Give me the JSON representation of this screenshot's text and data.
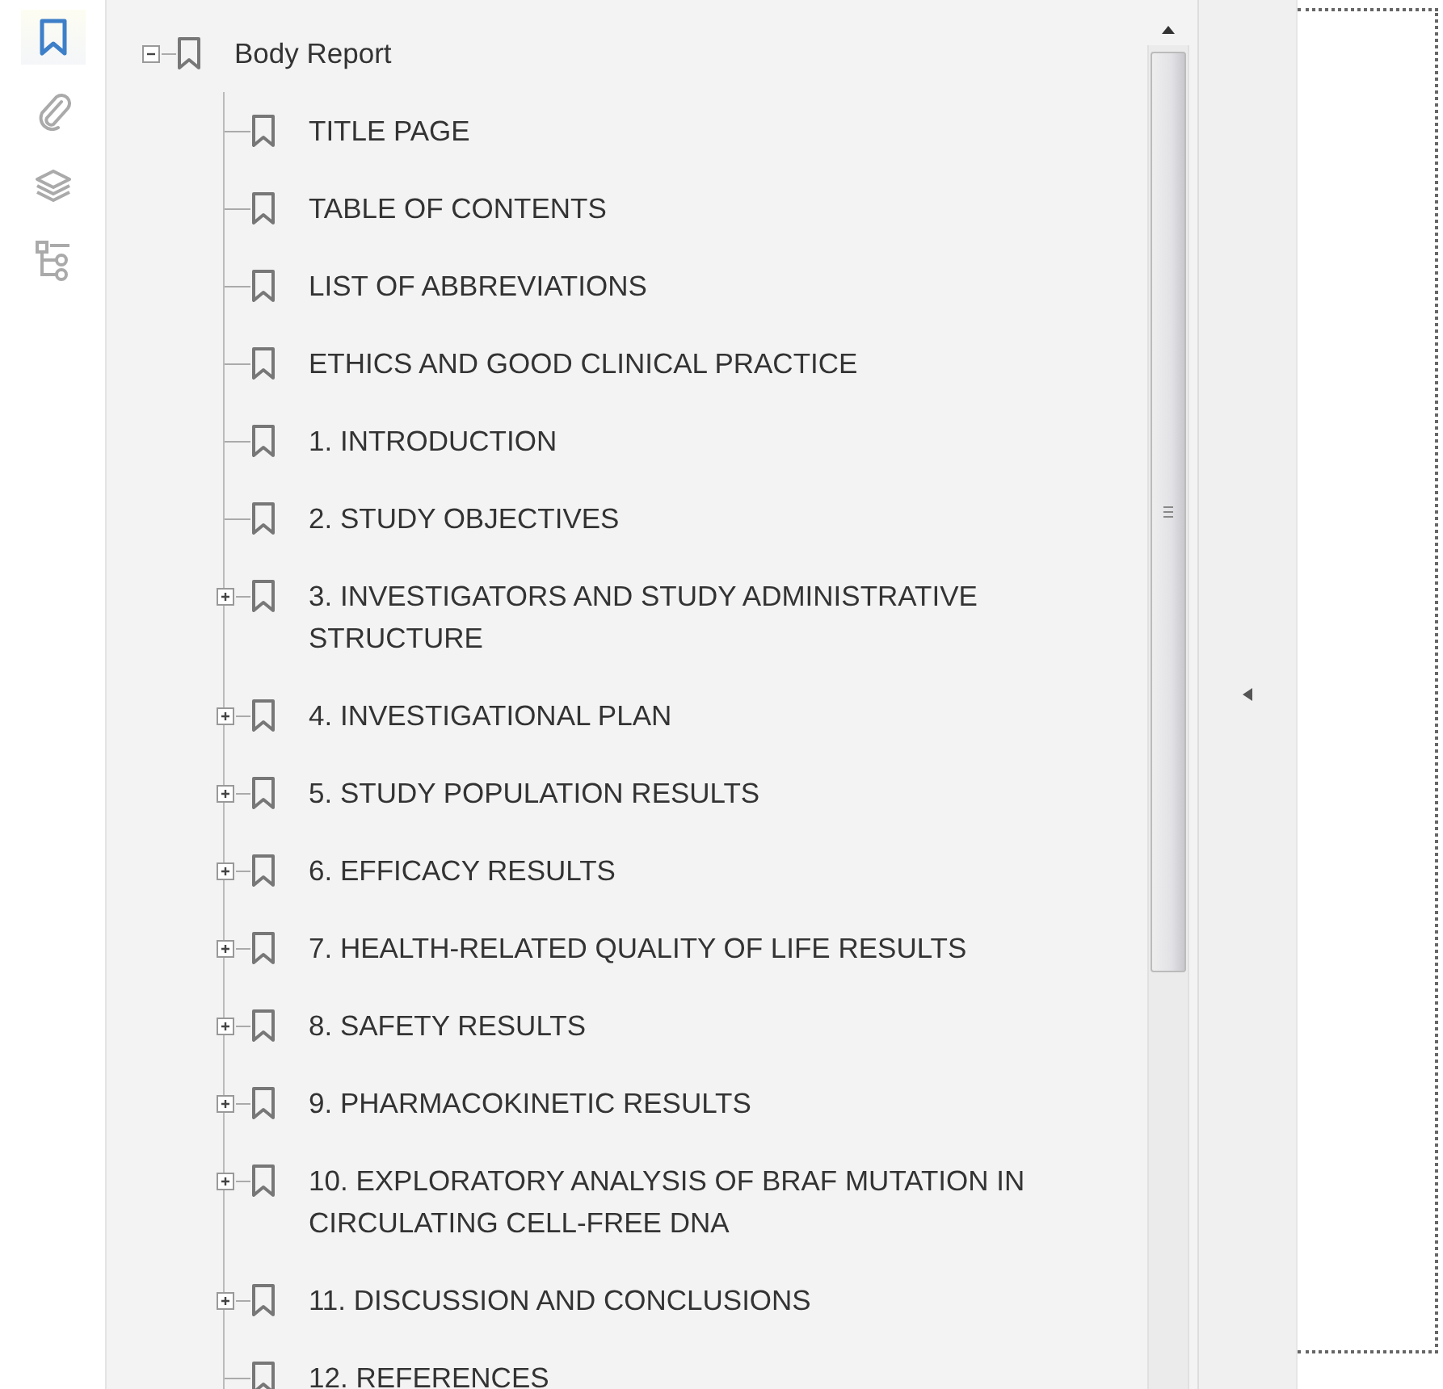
{
  "tools": [
    {
      "kind": "bookmarks",
      "selected": true
    },
    {
      "kind": "attachments",
      "selected": false
    },
    {
      "kind": "layers",
      "selected": false
    },
    {
      "kind": "structure",
      "selected": false
    }
  ],
  "bookmarks": [
    {
      "label": "Body Report",
      "kind": "branch",
      "expanded": true,
      "children": [
        {
          "label": "TITLE PAGE",
          "kind": "leaf"
        },
        {
          "label": "TABLE OF CONTENTS",
          "kind": "leaf"
        },
        {
          "label": "LIST OF ABBREVIATIONS",
          "kind": "leaf"
        },
        {
          "label": "ETHICS AND GOOD CLINICAL PRACTICE",
          "kind": "leaf"
        },
        {
          "label": "1. INTRODUCTION",
          "kind": "leaf"
        },
        {
          "label": "2. STUDY OBJECTIVES",
          "kind": "leaf"
        },
        {
          "label": "3. INVESTIGATORS AND STUDY ADMINISTRATIVE STRUCTURE",
          "kind": "branch",
          "expanded": false
        },
        {
          "label": "4. INVESTIGATIONAL PLAN",
          "kind": "branch",
          "expanded": false
        },
        {
          "label": "5. STUDY POPULATION RESULTS",
          "kind": "branch",
          "expanded": false
        },
        {
          "label": "6. EFFICACY RESULTS",
          "kind": "branch",
          "expanded": false
        },
        {
          "label": "7. HEALTH-RELATED QUALITY OF LIFE RESULTS",
          "kind": "branch",
          "expanded": false
        },
        {
          "label": "8. SAFETY RESULTS",
          "kind": "branch",
          "expanded": false
        },
        {
          "label": "9. PHARMACOKINETIC RESULTS",
          "kind": "branch",
          "expanded": false
        },
        {
          "label": "10. EXPLORATORY ANALYSIS OF BRAF MUTATION IN CIRCULATING CELL-FREE DNA",
          "kind": "branch",
          "expanded": false
        },
        {
          "label": "11. DISCUSSION AND CONCLUSIONS",
          "kind": "branch",
          "expanded": false
        },
        {
          "label": "12. REFERENCES",
          "kind": "leaf"
        }
      ]
    }
  ]
}
